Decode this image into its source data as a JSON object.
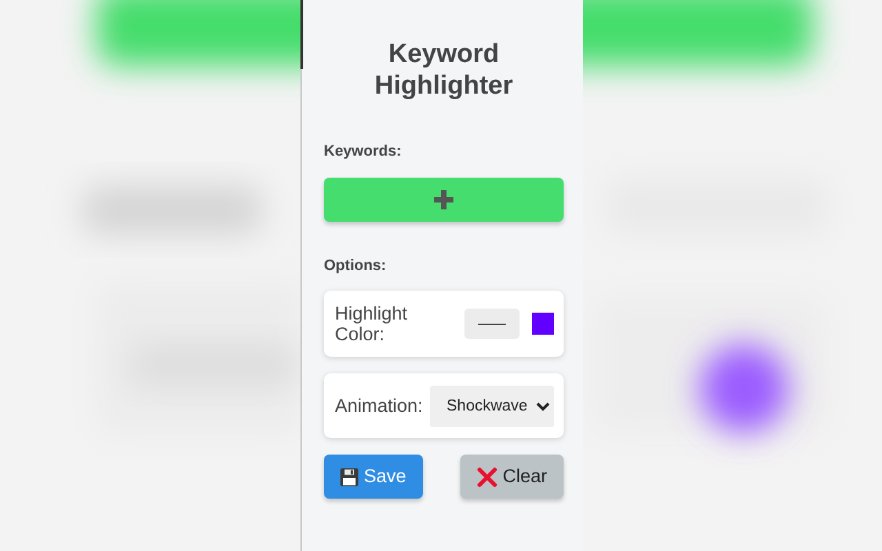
{
  "title": "Keyword Highlighter",
  "keywords": {
    "label": "Keywords:"
  },
  "options_label": "Options:",
  "options": [
    {
      "kind": "color",
      "label": "Highlight Color:",
      "color": "#6200ff"
    },
    {
      "kind": "select",
      "label": "Animation:",
      "value": "Shockwave"
    }
  ],
  "buttons": [
    {
      "kind": "save",
      "label": "Save"
    },
    {
      "kind": "clear",
      "label": "Clear"
    }
  ]
}
